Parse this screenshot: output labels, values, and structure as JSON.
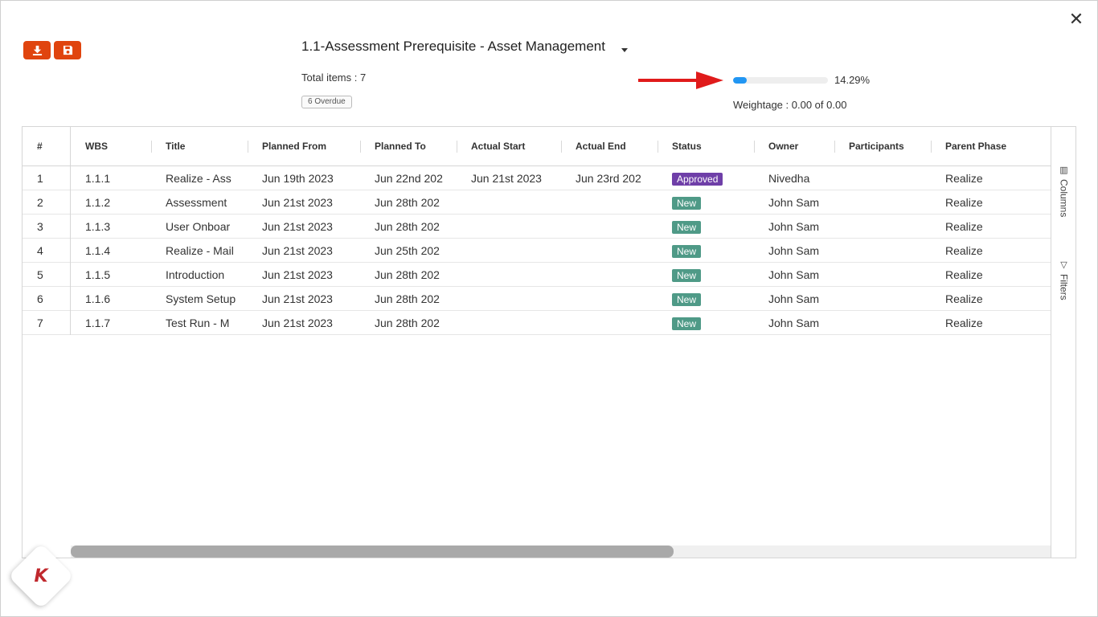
{
  "dialog": {
    "close_label": "✕"
  },
  "toolbar": {
    "download_icon": "download-icon",
    "save_icon": "save-icon"
  },
  "header": {
    "title": "1.1-Assessment Prerequisite - Asset Management",
    "total_items": "Total items : 7",
    "overdue_badge": "6 Overdue",
    "progress_value": 14.29,
    "progress_label": "14.29%",
    "weightage": "Weightage : 0.00 of 0.00",
    "progress_color": "#2196f3",
    "arrow_color": "#e01b1b"
  },
  "grid": {
    "columns": [
      "#",
      "WBS",
      "Title",
      "Planned From",
      "Planned To",
      "Actual Start",
      "Actual End",
      "Status",
      "Owner",
      "Participants",
      "Parent Phase"
    ],
    "rows": [
      [
        "1",
        "1.1.1",
        "Realize - Ass",
        "Jun 19th 2023",
        "Jun 22nd 202",
        "Jun 21st 2023",
        "Jun 23rd 202",
        "Approved",
        "Nivedha",
        "",
        "Realize"
      ],
      [
        "2",
        "1.1.2",
        "Assessment",
        "Jun 21st 2023",
        "Jun 28th 202",
        "",
        "",
        "New",
        "John Sam",
        "",
        "Realize"
      ],
      [
        "3",
        "1.1.3",
        "User Onboar",
        "Jun 21st 2023",
        "Jun 28th 202",
        "",
        "",
        "New",
        "John Sam",
        "",
        "Realize"
      ],
      [
        "4",
        "1.1.4",
        "Realize - Mail",
        "Jun 21st 2023",
        "Jun 25th 202",
        "",
        "",
        "New",
        "John Sam",
        "",
        "Realize"
      ],
      [
        "5",
        "1.1.5",
        "Introduction",
        "Jun 21st 2023",
        "Jun 28th 202",
        "",
        "",
        "New",
        "John Sam",
        "",
        "Realize"
      ],
      [
        "6",
        "1.1.6",
        "System Setup",
        "Jun 21st 2023",
        "Jun 28th 202",
        "",
        "",
        "New",
        "John Sam",
        "",
        "Realize"
      ],
      [
        "7",
        "1.1.7",
        "Test Run - M",
        "Jun 21st 2023",
        "Jun 28th 202",
        "",
        "",
        "New",
        "John Sam",
        "",
        "Realize"
      ]
    ],
    "status_colors": {
      "Approved": "#6f3fa8",
      "New": "#4f9a87"
    }
  },
  "side_panel": {
    "columns_label": "Columns",
    "filters_label": "Filters"
  },
  "logo": {
    "letter": "K",
    "color": "#c0282d"
  }
}
